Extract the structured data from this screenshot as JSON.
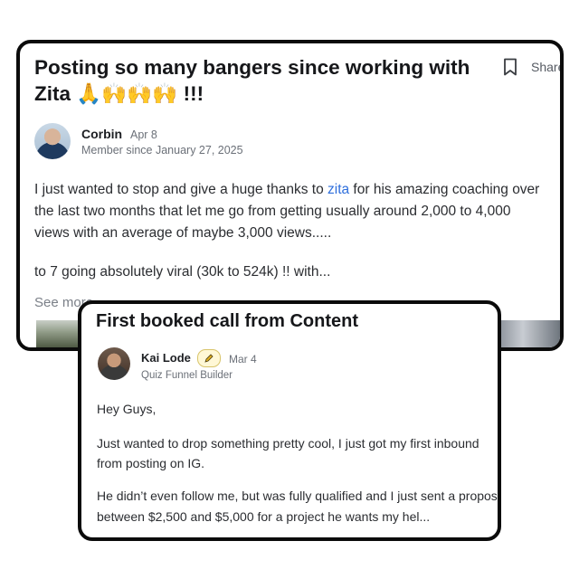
{
  "post1": {
    "title": "Posting so many bangers since working with Zita",
    "title_emojis": "🙏🙌🙌🙌",
    "title_suffix": " !!!",
    "bookmark_icon": "bookmark-icon",
    "share_label": "Share",
    "author": "Corbin",
    "date": "Apr 8",
    "member_since": "Member since January 27, 2025",
    "body_line1_before": "I just wanted to stop and give a huge thanks to ",
    "body_link": "zita",
    "body_line1_after": " for his amazing coaching over",
    "body_line2": "the last two months that let me go from getting usually around 2,000 to 4,000",
    "body_line3": "views with an average of maybe 3,000 views.....",
    "body_paragraph2": "to 7 going absolutely viral (30k to 524k) !! with...",
    "see_more": "See more"
  },
  "post2": {
    "title": "First booked call from Content",
    "author": "Kai Lode",
    "badge_icon": "pencil-icon",
    "date": "Mar 4",
    "role": "Quiz Funnel Builder",
    "greeting": "Hey Guys,",
    "para1_line1": "Just wanted to drop something pretty cool, I just got my first inbound",
    "para1_line2": "from posting on IG.",
    "para2_line1": "He didn’t even follow me, but was fully qualified and I just sent a proposal",
    "para2_line2": "between $2,500 and $5,000 for a project he wants my hel..."
  },
  "colors": {
    "link": "#2f6fdc",
    "border": "#0b0b0b",
    "text": "#2b2d31",
    "muted": "#6b7078"
  }
}
